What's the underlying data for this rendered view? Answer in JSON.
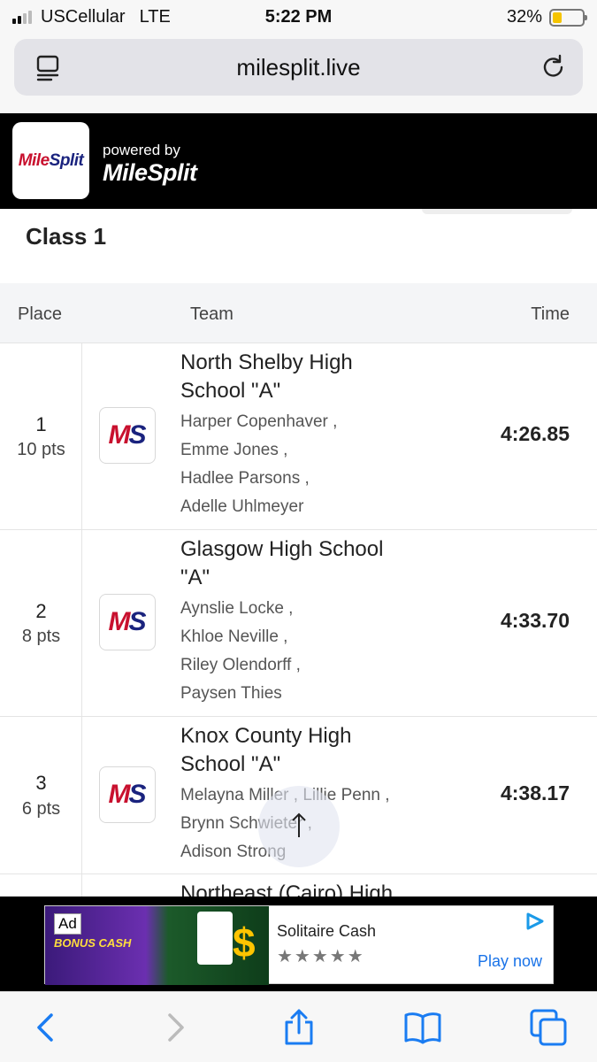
{
  "status": {
    "carrier": "USCellular",
    "network": "LTE",
    "time": "5:22 PM",
    "battery": "32%",
    "battery_level": 0.32
  },
  "browser": {
    "url": "milesplit.live"
  },
  "brand": {
    "logo_text_a": "Mile",
    "logo_text_b": "Split",
    "powered_by": "powered by",
    "powered_brand": "MileSplit"
  },
  "page": {
    "heading": "Class 1"
  },
  "table": {
    "headers": {
      "place": "Place",
      "team": "Team",
      "time": "Time"
    },
    "rows": [
      {
        "place": "1",
        "pts": "10 pts",
        "team": "North Shelby High School \"A\"",
        "athletes": [
          "Harper Copenhaver ,",
          "Emme Jones ,",
          "Hadlee Parsons ,",
          "Adelle Uhlmeyer"
        ],
        "time": "4:26.85"
      },
      {
        "place": "2",
        "pts": "8 pts",
        "team": "Glasgow High School \"A\"",
        "athletes": [
          "Aynslie Locke ,",
          "Khloe Neville ,",
          "Riley Olendorff ,",
          "Paysen Thies"
        ],
        "time": "4:33.70"
      },
      {
        "place": "3",
        "pts": "6 pts",
        "team": "Knox County High School \"A\"",
        "athletes": [
          "Melayna Miller , Lillie Penn ,",
          "Brynn Schwieter ,",
          "Adison Strong"
        ],
        "time": "4:38.17"
      },
      {
        "team": "Northeast (Cairo) High"
      }
    ]
  },
  "ad": {
    "tag": "Ad",
    "bonus": "BONUS CASH",
    "title": "Solitaire Cash",
    "stars": "★★★★★",
    "cta": "Play now"
  }
}
